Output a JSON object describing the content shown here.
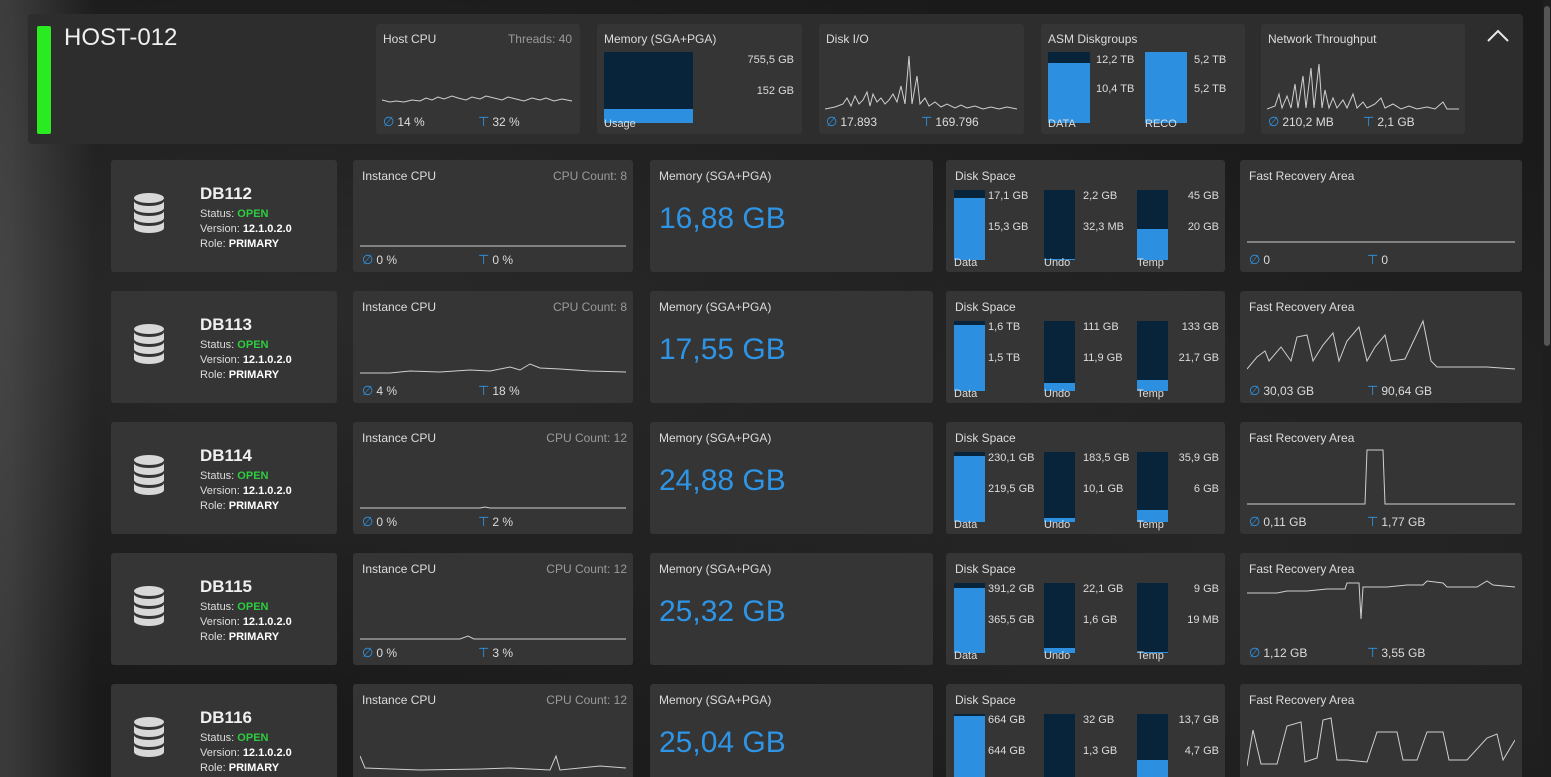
{
  "host": {
    "name": "HOST-012",
    "status_color": "#2aeb1f",
    "cpu": {
      "title": "Host CPU",
      "threads": "Threads: 40",
      "avg": "14 %",
      "max": "32 %"
    },
    "memory": {
      "title": "Memory (SGA+PGA)",
      "total": "755,5 GB",
      "used": "152 GB",
      "label": "Usage",
      "fraction": 0.2
    },
    "disk_io": {
      "title": "Disk I/O",
      "avg": "17.893",
      "max": "169.796"
    },
    "asm": {
      "title": "ASM Diskgroups",
      "groups": [
        {
          "label": "DATA",
          "total": "12,2 TB",
          "used": "10,4 TB",
          "fraction": 0.85
        },
        {
          "label": "RECO",
          "total": "5,2 TB",
          "used": "5,2 TB",
          "fraction": 1.0
        }
      ]
    },
    "network": {
      "title": "Network Throughput",
      "avg": "210,2 MB",
      "max": "2,1 GB"
    }
  },
  "labels": {
    "status": "Status: ",
    "version": "Version: ",
    "role": "Role: ",
    "instance_cpu": "Instance CPU",
    "memory": "Memory (SGA+PGA)",
    "disk_space": "Disk Space",
    "fra": "Fast Recovery Area",
    "data": "Data",
    "undo": "Undo",
    "temp": "Temp"
  },
  "databases": [
    {
      "name": "DB112",
      "status": "OPEN",
      "version": "12.1.0.2.0",
      "role": "PRIMARY",
      "cpu_count": "CPU Count: 8",
      "cpu_avg": "0 %",
      "cpu_max": "0 %",
      "memory": "16,88 GB",
      "disk": {
        "data": {
          "total": "17,1 GB",
          "used": "15,3 GB",
          "fraction": 0.89
        },
        "undo": {
          "total": "2,2 GB",
          "used": "32,3 MB",
          "fraction": 0.015
        },
        "temp": {
          "total": "45 GB",
          "used": "20 GB",
          "fraction": 0.44
        }
      },
      "fra_avg": "0",
      "fra_max": "0"
    },
    {
      "name": "DB113",
      "status": "OPEN",
      "version": "12.1.0.2.0",
      "role": "PRIMARY",
      "cpu_count": "CPU Count: 8",
      "cpu_avg": "4 %",
      "cpu_max": "18 %",
      "memory": "17,55 GB",
      "disk": {
        "data": {
          "total": "1,6 TB",
          "used": "1,5 TB",
          "fraction": 0.94
        },
        "undo": {
          "total": "111 GB",
          "used": "11,9 GB",
          "fraction": 0.11
        },
        "temp": {
          "total": "133 GB",
          "used": "21,7 GB",
          "fraction": 0.16
        }
      },
      "fra_avg": "30,03 GB",
      "fra_max": "90,64 GB"
    },
    {
      "name": "DB114",
      "status": "OPEN",
      "version": "12.1.0.2.0",
      "role": "PRIMARY",
      "cpu_count": "CPU Count: 12",
      "cpu_avg": "0 %",
      "cpu_max": "2 %",
      "memory": "24,88 GB",
      "disk": {
        "data": {
          "total": "230,1 GB",
          "used": "219,5 GB",
          "fraction": 0.95
        },
        "undo": {
          "total": "183,5 GB",
          "used": "10,1 GB",
          "fraction": 0.055
        },
        "temp": {
          "total": "35,9 GB",
          "used": "6 GB",
          "fraction": 0.17
        }
      },
      "fra_avg": "0,11 GB",
      "fra_max": "1,77 GB"
    },
    {
      "name": "DB115",
      "status": "OPEN",
      "version": "12.1.0.2.0",
      "role": "PRIMARY",
      "cpu_count": "CPU Count: 12",
      "cpu_avg": "0 %",
      "cpu_max": "3 %",
      "memory": "25,32 GB",
      "disk": {
        "data": {
          "total": "391,2 GB",
          "used": "365,5 GB",
          "fraction": 0.93
        },
        "undo": {
          "total": "22,1 GB",
          "used": "1,6 GB",
          "fraction": 0.07
        },
        "temp": {
          "total": "9 GB",
          "used": "19 MB",
          "fraction": 0.01
        }
      },
      "fra_avg": "1,12 GB",
      "fra_max": "3,55 GB"
    },
    {
      "name": "DB116",
      "status": "OPEN",
      "version": "12.1.0.2.0",
      "role": "PRIMARY",
      "cpu_count": "CPU Count: 12",
      "cpu_avg": "",
      "cpu_max": "",
      "memory": "25,04 GB",
      "disk": {
        "data": {
          "total": "664 GB",
          "used": "644 GB",
          "fraction": 0.97
        },
        "undo": {
          "total": "32 GB",
          "used": "1,3 GB",
          "fraction": 0.04
        },
        "temp": {
          "total": "13,7 GB",
          "used": "4,7 GB",
          "fraction": 0.34
        }
      },
      "fra_avg": "",
      "fra_max": ""
    }
  ],
  "colors": {
    "accent": "#2e95e6",
    "bar_fill": "#2d8fe0",
    "bar_bg": "#08243a",
    "open": "#2ecc40"
  }
}
